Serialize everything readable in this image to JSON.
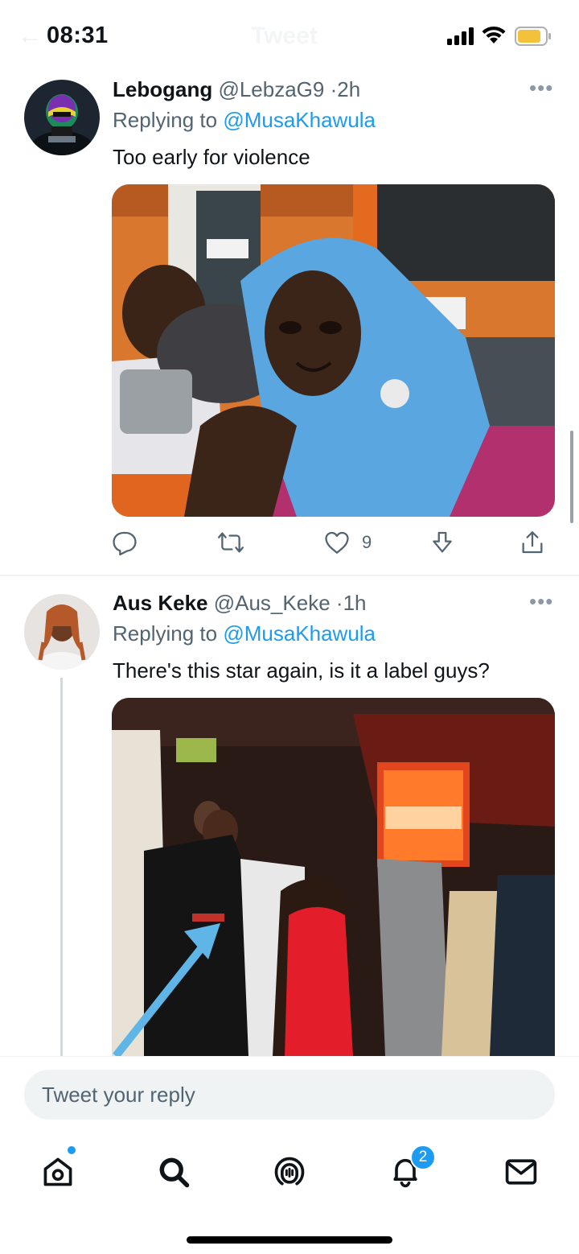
{
  "status_bar": {
    "time": "08:31",
    "ghost_title": "Tweet",
    "icons": [
      "cellular-signal-icon",
      "wifi-icon",
      "battery-icon"
    ],
    "battery_color": "#f4c13a"
  },
  "tweets": [
    {
      "name": "Lebogang",
      "handle": "@LebzaG9",
      "separator": "·",
      "time": "2h",
      "replying_prefix": "Replying to",
      "replying_to": "@MusaKhawula",
      "text": "Too early for violence",
      "media_icon": "photo-crying-man-radio-studio",
      "like_count": "9"
    },
    {
      "name": "Aus Keke",
      "handle": "@Aus_Keke",
      "separator": "·",
      "time": "1h",
      "replying_prefix": "Replying to",
      "replying_to": "@MusaKhawula",
      "text": "There's this star again, is it a label guys?",
      "media_icon": "photo-club-crowd-hustle-larder"
    }
  ],
  "composer": {
    "placeholder": "Tweet your reply"
  },
  "tab_bar": {
    "items": [
      "home-icon",
      "search-icon",
      "spaces-icon",
      "notifications-icon",
      "messages-icon"
    ],
    "notifications_badge": "2"
  },
  "colors": {
    "accent": "#1d9bf0",
    "text": "#0f1419",
    "secondary": "#536471"
  }
}
